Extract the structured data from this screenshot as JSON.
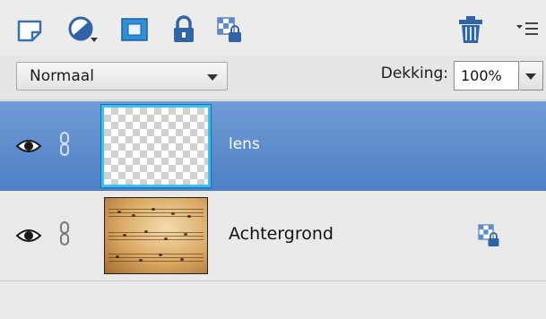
{
  "blend_mode": {
    "value": "Normaal"
  },
  "opacity": {
    "label": "Dekking:",
    "value": "100%"
  },
  "layers": [
    {
      "name": "lens",
      "selected": true,
      "visible": true,
      "thumbnail": "transparent-checkerboard"
    },
    {
      "name": "Achtergrond",
      "selected": false,
      "visible": true,
      "thumbnail": "sheet-music-photo",
      "locked": true
    }
  ],
  "toolbar": {
    "icons": [
      "new-layer-icon",
      "adjustment-layer-icon",
      "layer-mask-icon",
      "lock-all-icon",
      "lock-transparency-icon",
      "trash-icon",
      "panel-menu-icon"
    ]
  },
  "colors": {
    "selection": "#5b8ccd",
    "thumb_highlight": "#37c2f0",
    "accent_blue": "#2b8fd6"
  }
}
